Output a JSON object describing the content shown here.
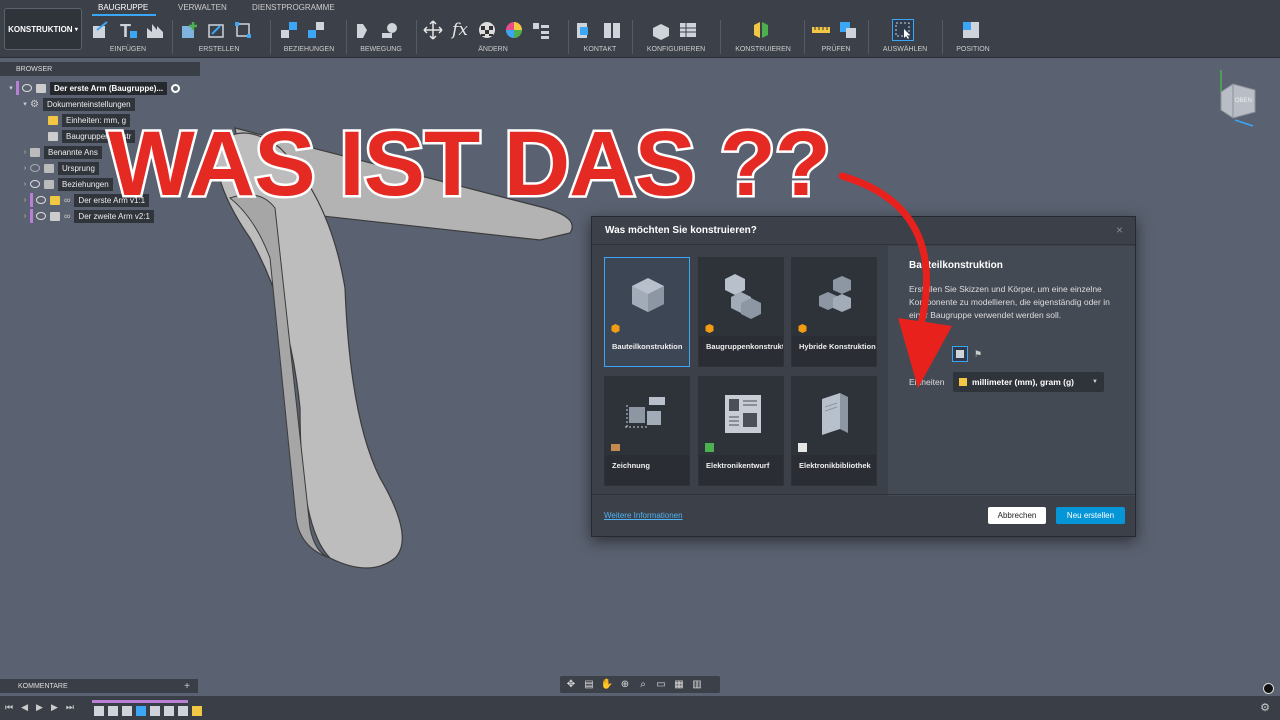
{
  "workspace": {
    "label": "KONSTRUKTION"
  },
  "tabs": [
    {
      "label": "BAUGRUPPE",
      "active": true
    },
    {
      "label": "VERWALTEN",
      "active": false
    },
    {
      "label": "DIENSTPROGRAMME",
      "active": false
    }
  ],
  "toolbar_groups": [
    {
      "label": "EINFÜGEN"
    },
    {
      "label": "ERSTELLEN"
    },
    {
      "label": "BEZIEHUNGEN"
    },
    {
      "label": "BEWEGUNG"
    },
    {
      "label": "ÄNDERN"
    },
    {
      "label": "KONTAKT"
    },
    {
      "label": "KONFIGURIEREN"
    },
    {
      "label": "KONSTRUIEREN"
    },
    {
      "label": "PRÜFEN"
    },
    {
      "label": "AUSWÄHLEN"
    },
    {
      "label": "POSITION"
    }
  ],
  "browser": {
    "title": "BROWSER",
    "items": [
      {
        "label": "Der erste Arm (Baugruppe)..."
      },
      {
        "label": "Dokumenteinstellungen"
      },
      {
        "label": "Einheiten: mm, g"
      },
      {
        "label": "Baugruppenkonstr"
      },
      {
        "label": "Benannte Ans"
      },
      {
        "label": "Ursprung"
      },
      {
        "label": "Beziehungen"
      },
      {
        "label": "Der erste Arm v1:1"
      },
      {
        "label": "Der zweite Arm v2:1"
      }
    ]
  },
  "headline": "WAS IST DAS ??",
  "dialog": {
    "title": "Was möchten Sie konstruieren?",
    "options": [
      {
        "label": "Bauteilkonstruktion",
        "selected": true
      },
      {
        "label": "Baugruppenkonstruktion",
        "selected": false
      },
      {
        "label": "Hybride Konstruktion",
        "selected": false
      },
      {
        "label": "Zeichnung",
        "selected": false
      },
      {
        "label": "Elektronikentwurf",
        "selected": false
      },
      {
        "label": "Elektronikbibliothek",
        "selected": false
      }
    ],
    "panel_title": "Bauteilkonstruktion",
    "panel_desc": "Erstellen Sie Skizzen und Körper, um eine einzelne Komponente zu modellieren, die eigenständig oder in einer Baugruppe verwendet werden soll.",
    "units_label": "Einheiten",
    "units_value": "millimeter (mm), gram (g)",
    "more_info": "Weitere Informationen",
    "cancel": "Abbrechen",
    "create": "Neu erstellen"
  },
  "viewcube": {
    "label": "OBEN"
  },
  "comments": {
    "label": "KOMMENTARE"
  },
  "colors": {
    "accent": "#0696d7",
    "headline": "#e52a24",
    "arrow": "#e8211d"
  }
}
